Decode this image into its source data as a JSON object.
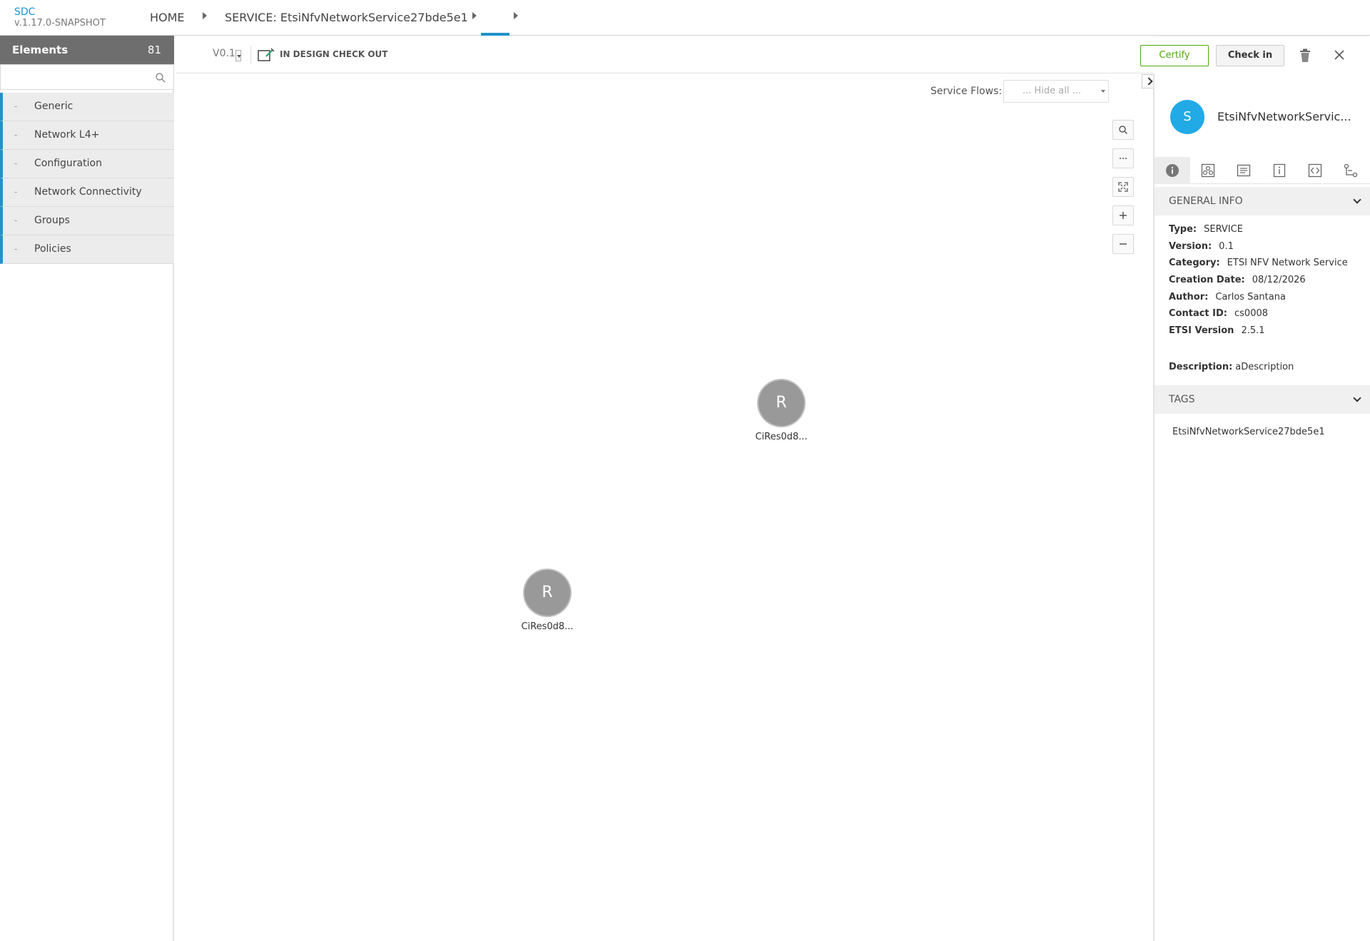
{
  "app": {
    "name": "SDC",
    "version": "v.1.17.0-SNAPSHOT"
  },
  "breadcrumb": {
    "home": "HOME",
    "service": "SERVICE: EtsiNfvNetworkService27bde5e1"
  },
  "palette": {
    "title": "Elements",
    "count": "81",
    "search_placeholder": "",
    "categories": [
      {
        "dash": "-",
        "label": "Generic"
      },
      {
        "dash": "-",
        "label": "Network L4+"
      },
      {
        "dash": "-",
        "label": "Configuration"
      },
      {
        "dash": "-",
        "label": "Network Connectivity"
      },
      {
        "dash": "-",
        "label": "Groups"
      },
      {
        "dash": "-",
        "label": "Policies"
      }
    ]
  },
  "toolbar": {
    "version": "V0.1",
    "status": "IN DESIGN CHECK OUT",
    "certify_label": "Certify",
    "checkin_label": "Check in"
  },
  "canvas": {
    "service_flows_label": "Service Flows:",
    "service_flows_value": "... Hide all ...",
    "zoom_controls": [
      "search-icon",
      "more-icon",
      "fit-icon",
      "zoom-in-icon",
      "zoom-out-icon"
    ],
    "nodes": [
      {
        "letter": "R",
        "label": "CiRes0d8..."
      },
      {
        "letter": "R",
        "label": "CiRes0d8..."
      }
    ]
  },
  "right_panel": {
    "avatar_letter": "S",
    "name": "EtsiNfvNetworkServic...",
    "tabs": [
      "info-icon",
      "composition-icon",
      "artifacts-icon",
      "properties-icon",
      "api-icon",
      "relations-icon"
    ],
    "general_info_title": "GENERAL INFO",
    "info": {
      "type_label": "Type:",
      "type": "SERVICE",
      "version_label": "Version:",
      "version": "0.1",
      "category_label": "Category:",
      "category": "ETSI NFV Network Service",
      "creation_label": "Creation Date:",
      "creation": "08/12/2026",
      "author_label": "Author:",
      "author": "Carlos Santana",
      "contact_label": "Contact ID:",
      "contact": "cs0008",
      "etsi_label": "ETSI Version",
      "etsi": "2.5.1",
      "description_label": "Description:",
      "description": "aDescription"
    },
    "tags_title": "TAGS",
    "tags": [
      "EtsiNfvNetworkService27bde5e1"
    ]
  },
  "colors": {
    "accent": "#1f93c8",
    "certify": "#4ca90c",
    "avatar": "#22aae6",
    "node": "#999999"
  }
}
